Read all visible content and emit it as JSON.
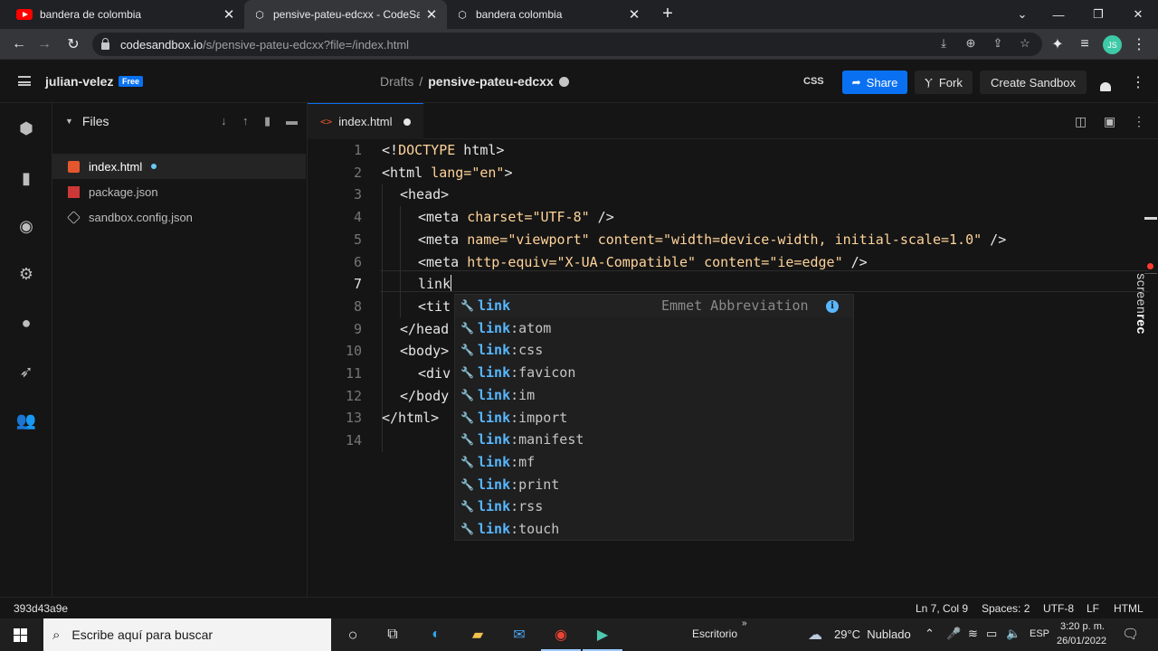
{
  "browser": {
    "tabs": [
      {
        "title": "bandera de colombia",
        "icon": "youtube-icon",
        "active": false
      },
      {
        "title": "pensive-pateu-edcxx - CodeSand",
        "icon": "codesandbox-icon",
        "active": true
      },
      {
        "title": "bandera colombia",
        "icon": "codesandbox-icon",
        "active": false
      }
    ],
    "url_host": "codesandbox.io",
    "url_path": "/s/pensive-pateu-edcxx?file=/index.html",
    "avatar_initials": "JS"
  },
  "header": {
    "username": "julian-velez",
    "plan_badge": "Free",
    "breadcrumb_parent": "Drafts",
    "breadcrumb_sep": "/",
    "sandbox_name": "pensive-pateu-edcxx",
    "css_badge": "CSS",
    "share_label": "Share",
    "fork_label": "Fork",
    "create_label": "Create Sandbox"
  },
  "explorer": {
    "title": "Files",
    "files": [
      {
        "name": "index.html",
        "icon": "html5-icon",
        "active": true,
        "modified": true
      },
      {
        "name": "package.json",
        "icon": "npm-icon",
        "active": false,
        "modified": false
      },
      {
        "name": "sandbox.config.json",
        "icon": "cube-icon",
        "active": false,
        "modified": false
      }
    ]
  },
  "editor": {
    "tab_label": "index.html",
    "line_numbers": [
      "1",
      "2",
      "3",
      "4",
      "5",
      "6",
      "7",
      "8",
      "9",
      "10",
      "11",
      "12",
      "13",
      "14"
    ],
    "current_line": 7,
    "lines": {
      "l1_a": "<!",
      "l1_b": "DOCTYPE",
      "l1_c": " html>",
      "l2_a": "<html ",
      "l2_b": "lang=",
      "l2_c": "\"en\"",
      "l2_d": ">",
      "l3": "<head>",
      "l4_a": "<meta ",
      "l4_b": "charset=",
      "l4_c": "\"UTF-8\"",
      "l4_d": " />",
      "l5_a": "<meta ",
      "l5_b": "name=",
      "l5_c": "\"viewport\"",
      "l5_d": " ",
      "l5_e": "content=",
      "l5_f": "\"width=device-width, initial-scale=1.0\"",
      "l5_g": " />",
      "l6_a": "<meta ",
      "l6_b": "http-equiv=",
      "l6_c": "\"X-UA-Compatible\"",
      "l6_d": " ",
      "l6_e": "content=",
      "l6_f": "\"ie=edge\"",
      "l6_g": " />",
      "l7": "link",
      "l8": "<tit",
      "l9": "</head",
      "l10": "<body>",
      "l11": "<div",
      "l12": "</body",
      "l13": "</html>"
    }
  },
  "suggest": {
    "match": "link",
    "detail": "Emmet Abbreviation",
    "items": [
      "",
      ":atom",
      ":css",
      ":favicon",
      ":im",
      ":import",
      ":manifest",
      ":mf",
      ":print",
      ":rss",
      ":touch"
    ]
  },
  "status": {
    "commit": "393d43a9e",
    "position": "Ln 7, Col 9",
    "spaces": "Spaces: 2",
    "encoding": "UTF-8",
    "eol": "LF",
    "language": "HTML"
  },
  "watermark": {
    "prefix": "screen",
    "suffix": "rec"
  },
  "taskbar": {
    "search_placeholder": "Escribe aquí para buscar",
    "desktop_label": "Escritorio",
    "weather": "29°C  Nublado",
    "lang": "ESP",
    "time": "3:20 p. m.",
    "date": "26/01/2022"
  },
  "colors": {
    "accent": "#0971f1",
    "string": "#ffd399",
    "match": "#58b7ff"
  }
}
